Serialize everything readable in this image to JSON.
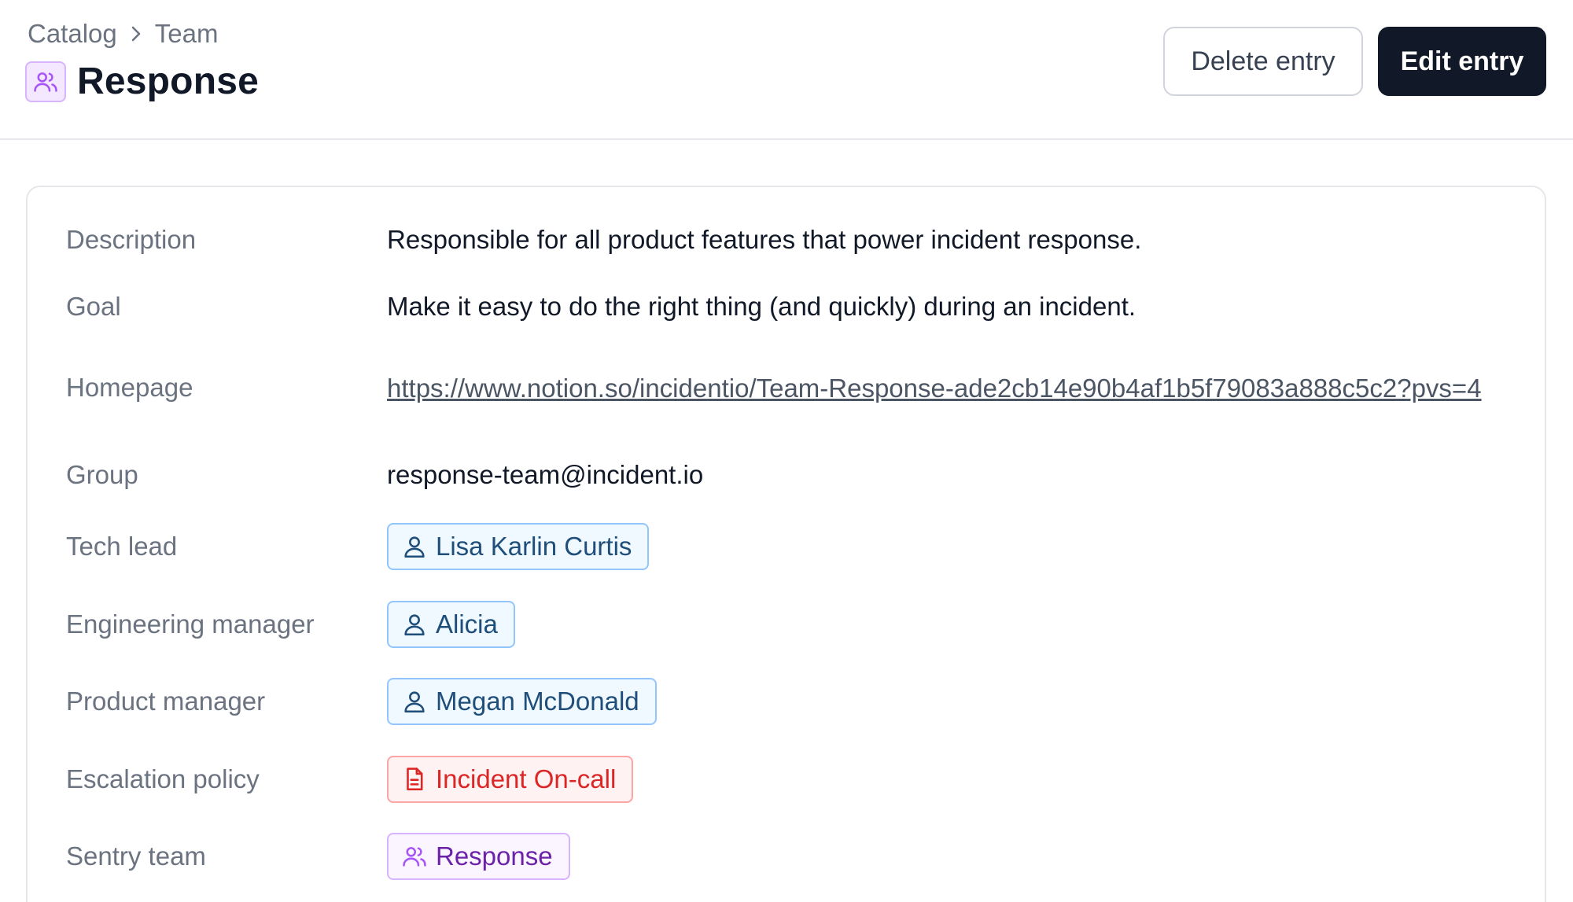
{
  "breadcrumb": {
    "root": "Catalog",
    "current": "Team"
  },
  "page": {
    "title": "Response"
  },
  "actions": {
    "delete_label": "Delete entry",
    "edit_label": "Edit entry"
  },
  "fields": {
    "description": {
      "label": "Description",
      "value": "Responsible for all product features that power incident response."
    },
    "goal": {
      "label": "Goal",
      "value": "Make it easy to do the right thing (and quickly) during an incident."
    },
    "homepage": {
      "label": "Homepage",
      "value": "https://www.notion.so/incidentio/Team-Response-ade2cb14e90b4af1b5f79083a888c5c2?pvs=4"
    },
    "group": {
      "label": "Group",
      "value": "response-team@incident.io"
    },
    "tech_lead": {
      "label": "Tech lead",
      "value": "Lisa Karlin Curtis"
    },
    "engineering_manager": {
      "label": "Engineering manager",
      "value": "Alicia"
    },
    "product_manager": {
      "label": "Product manager",
      "value": "Megan McDonald"
    },
    "escalation_policy": {
      "label": "Escalation policy",
      "value": "Incident On-call"
    },
    "sentry_team": {
      "label": "Sentry team",
      "value": "Response"
    }
  },
  "colors": {
    "primary_button": "#111827",
    "user_pill_border": "#93c5fd",
    "escalation_pill_text": "#dc2626",
    "team_accent": "#a855f7"
  },
  "icons": {
    "breadcrumb_separator": "chevron-right-icon",
    "team": "users-icon",
    "user": "user-icon",
    "escalation": "document-icon"
  }
}
